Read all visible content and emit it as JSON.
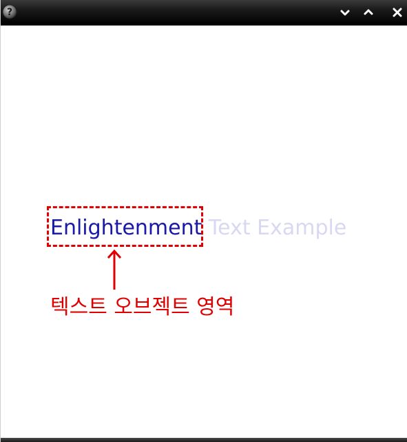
{
  "window": {
    "help_icon": "question-mark-icon",
    "controls": {
      "minimize_icon": "chevron-down-icon",
      "maximize_icon": "chevron-up-icon",
      "close_icon": "close-icon"
    }
  },
  "example": {
    "text": "Enlightenment Text Example",
    "visible_part_color": "#1a1aa6",
    "clipped_part_color": "#d8d8f0"
  },
  "annotation": {
    "label": "텍스트 오브젝트 영역",
    "color": "#e00000"
  }
}
